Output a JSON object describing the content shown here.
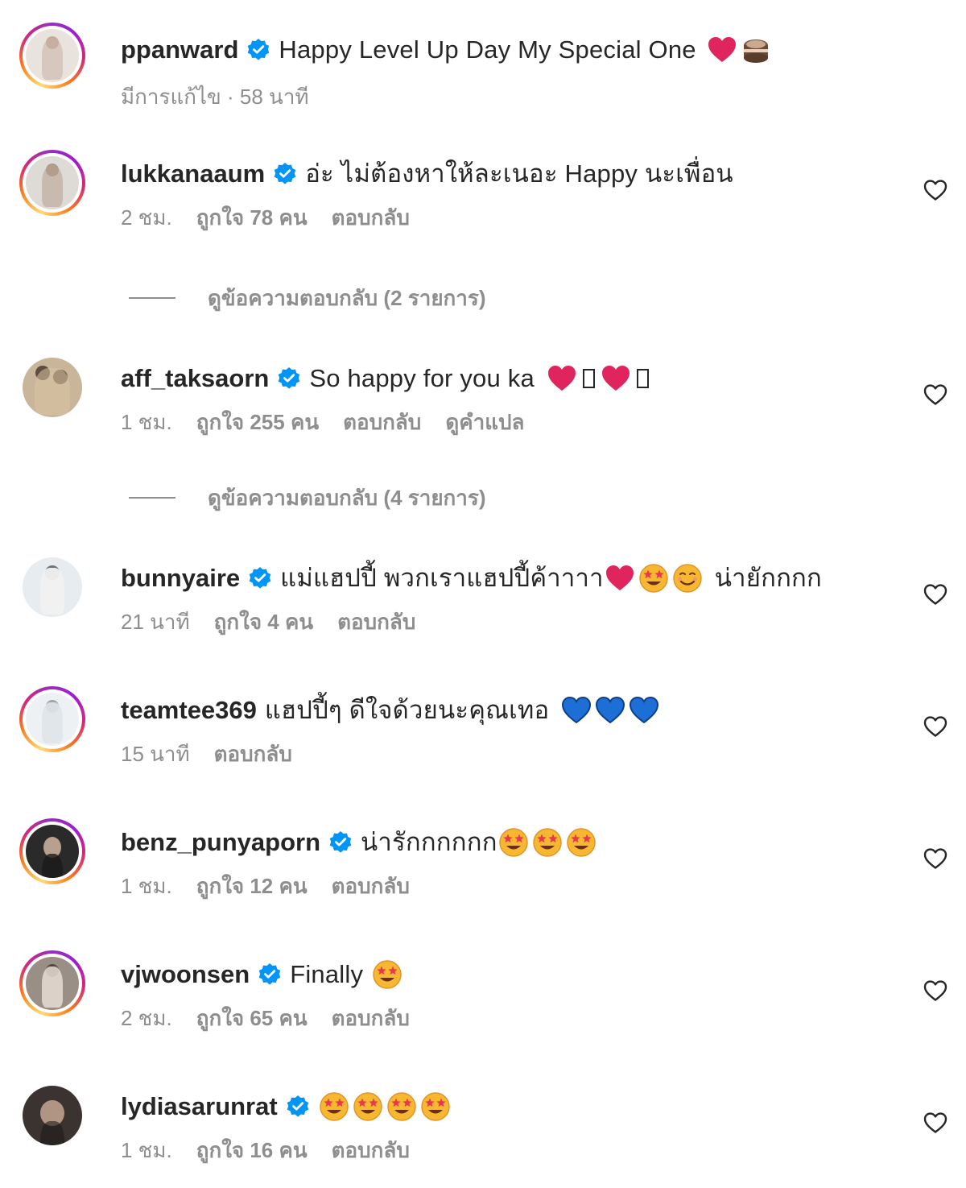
{
  "colors": {
    "text": "#262626",
    "muted": "#8e8e8e",
    "verified": "#0095f6",
    "heart_red": "#e0245e",
    "heart_blue": "#1d6fd6",
    "emoji_yellow": "#f7b731"
  },
  "caption": {
    "username": "ppanward",
    "verified": true,
    "text": "Happy Level Up Day My Special One",
    "emojis": [
      "red-heart-emoji",
      "cake-emoji"
    ],
    "meta": "มีการแก้ไข · 58 นาที"
  },
  "comments": [
    {
      "username": "lukkanaaum",
      "verified": true,
      "text": "อ่ะ ไม่ต้องหาให้ละเนอะ Happy นะเพื่อน",
      "emojis": [],
      "time": "2 ชม.",
      "likes": "ถูกใจ 78 คน",
      "reply": "ตอบกลับ",
      "translate": "",
      "view_replies": "ดูข้อความตอบกลับ (2 รายการ)"
    },
    {
      "username": "aff_taksaorn",
      "verified": true,
      "text": "So happy for you ka",
      "emojis": [
        "red-heart-emoji",
        "missing-glyph",
        "red-heart-emoji",
        "missing-glyph"
      ],
      "time": "1 ชม.",
      "likes": "ถูกใจ 255 คน",
      "reply": "ตอบกลับ",
      "translate": "ดูคำแปล",
      "view_replies": "ดูข้อความตอบกลับ (4 รายการ)"
    },
    {
      "username": "bunnyaire",
      "verified": true,
      "text": "แม่แฮปปี้ พวกเราแฮปปี้ค้าาาา",
      "emojis": [
        "red-heart-emoji",
        "star-eyes-emoji",
        "smiling-emoji"
      ],
      "text_after": "น่ายักกกก",
      "time": "21 นาที",
      "likes": "ถูกใจ 4 คน",
      "reply": "ตอบกลับ",
      "translate": "",
      "view_replies": ""
    },
    {
      "username": "teamtee369",
      "verified": false,
      "text": "แฮปปี้ๆ ดีใจด้วยนะคุณเทอ",
      "emojis": [
        "blue-heart-emoji",
        "blue-heart-emoji",
        "blue-heart-emoji"
      ],
      "time": "15 นาที",
      "likes": "",
      "reply": "ตอบกลับ",
      "translate": "",
      "view_replies": ""
    },
    {
      "username": "benz_punyaporn",
      "verified": true,
      "text": "น่ารักกกกกก",
      "emojis": [
        "star-eyes-emoji",
        "star-eyes-emoji",
        "star-eyes-emoji"
      ],
      "time": "1 ชม.",
      "likes": "ถูกใจ 12 คน",
      "reply": "ตอบกลับ",
      "translate": "",
      "view_replies": ""
    },
    {
      "username": "vjwoonsen",
      "verified": true,
      "text": "Finally",
      "emojis": [
        "star-eyes-emoji"
      ],
      "time": "2 ชม.",
      "likes": "ถูกใจ 65 คน",
      "reply": "ตอบกลับ",
      "translate": "",
      "view_replies": ""
    },
    {
      "username": "lydiasarunrat",
      "verified": true,
      "text": "",
      "emojis": [
        "star-eyes-emoji",
        "star-eyes-emoji",
        "star-eyes-emoji",
        "star-eyes-emoji"
      ],
      "time": "1 ชม.",
      "likes": "ถูกใจ 16 คน",
      "reply": "ตอบกลับ",
      "translate": "",
      "view_replies": ""
    }
  ]
}
